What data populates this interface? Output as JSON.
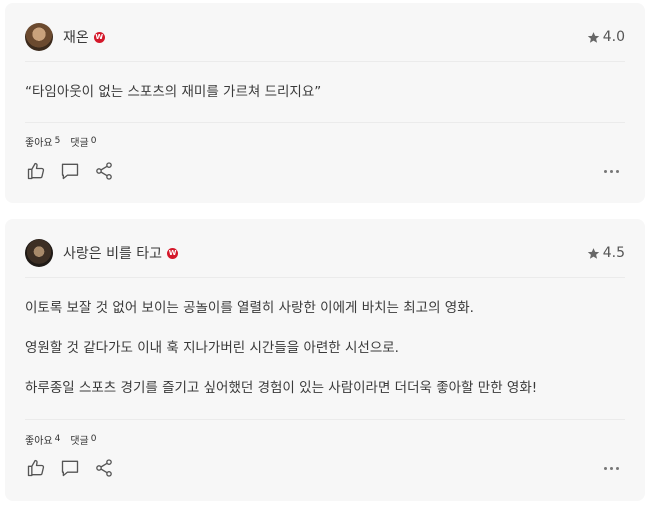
{
  "reviews": [
    {
      "username": "재온",
      "badge": "W",
      "rating": "4.0",
      "paragraphs": [
        "“타임아웃이 없는 스포츠의 재미를 가르쳐 드리지요”"
      ],
      "likes_label": "좋아요",
      "likes_count": "5",
      "comments_label": "댓글",
      "comments_count": "0"
    },
    {
      "username": "사랑은 비를 타고",
      "badge": "W",
      "rating": "4.5",
      "paragraphs": [
        "이토록 보잘 것 없어 보이는 공놀이를 열렬히 사랑한 이에게 바치는 최고의 영화.",
        "영원할 것 같다가도 이내 훅 지나가버린 시간들을 아련한 시선으로.",
        "하루종일 스포츠 경기를 즐기고 싶어했던 경험이 있는 사람이라면 더더욱 좋아할 만한 영화!"
      ],
      "likes_label": "좋아요",
      "likes_count": "4",
      "comments_label": "댓글",
      "comments_count": "0"
    }
  ],
  "icons": {
    "star": "star-icon",
    "like": "thumbs-up-icon",
    "comment": "comment-icon",
    "share": "share-icon",
    "more": "more-icon"
  },
  "colors": {
    "badge": "#d4182a",
    "card": "#f7f7f7"
  }
}
